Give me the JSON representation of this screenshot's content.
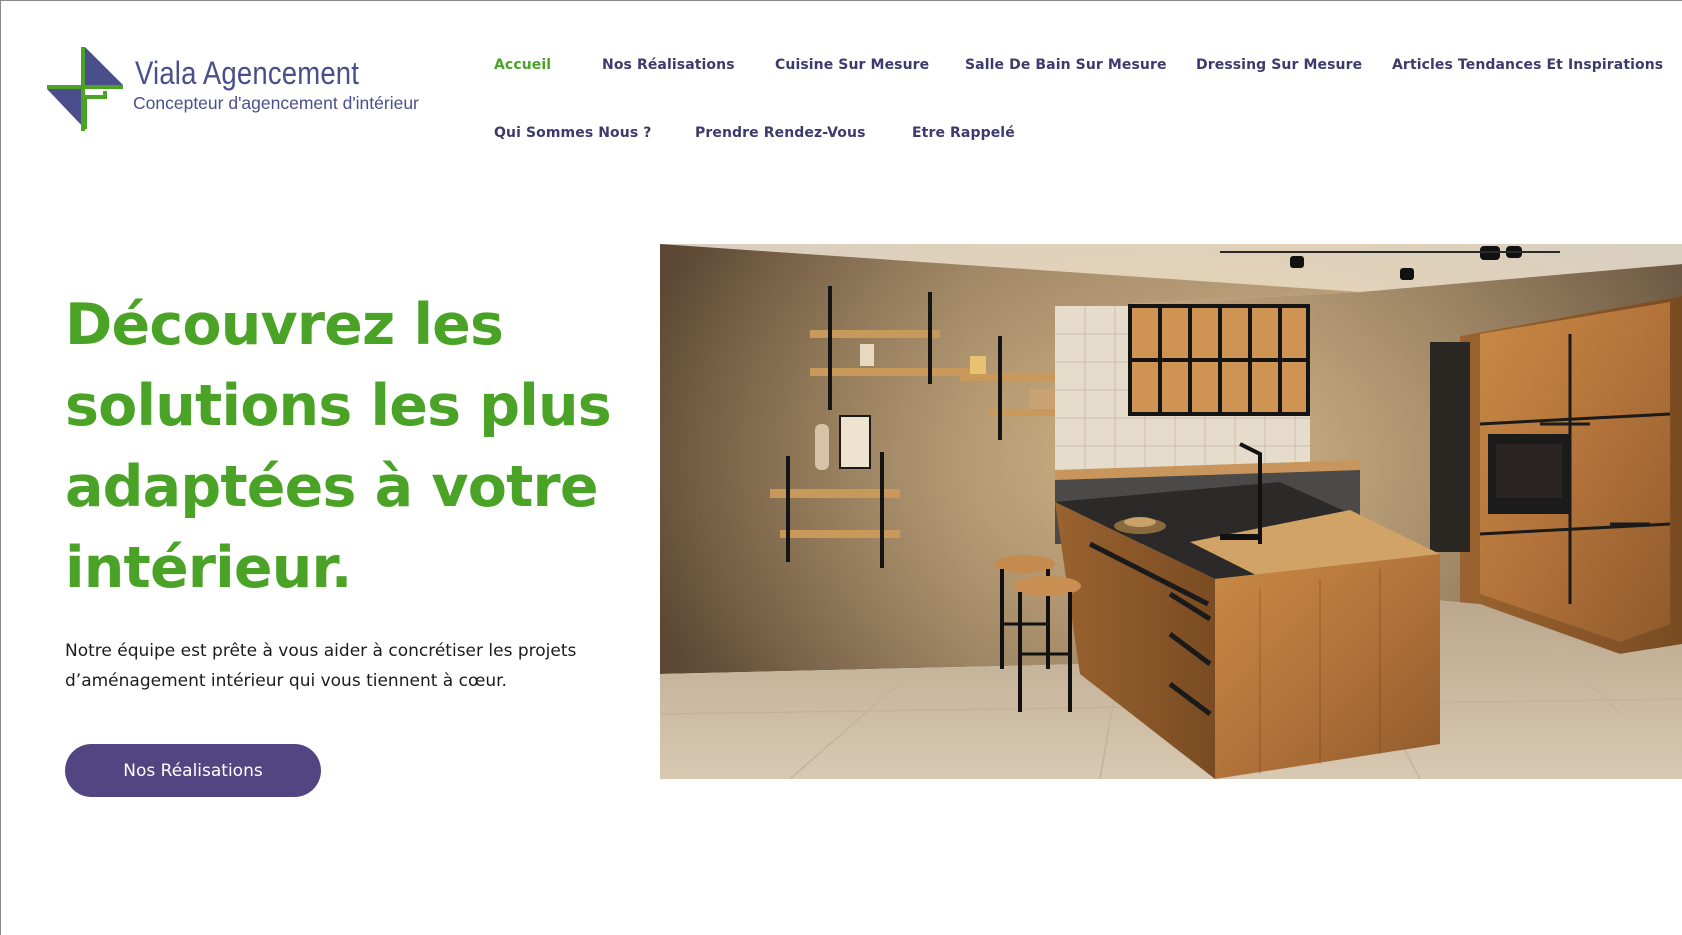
{
  "brand": {
    "name": "Viala Agencement",
    "tagline": "Concepteur d'agencement d'intérieur",
    "colors": {
      "green": "#4aa326",
      "purple": "#524682",
      "nav_text": "#3e3a6d"
    }
  },
  "nav": {
    "items": [
      {
        "label": "Accueil",
        "active": true
      },
      {
        "label": "Nos Réalisations"
      },
      {
        "label": "Cuisine Sur Mesure"
      },
      {
        "label": "Salle De Bain Sur Mesure"
      },
      {
        "label": "Dressing Sur Mesure"
      },
      {
        "label": "Articles Tendances Et Inspirations"
      },
      {
        "label": "Qui Sommes Nous ?"
      },
      {
        "label": "Prendre Rendez-Vous"
      },
      {
        "label": "Etre Rappelé"
      }
    ]
  },
  "hero": {
    "title": "Découvrez les solutions les plus adaptées à votre intérieur.",
    "text": "Notre équipe est prête à vous aider à concrétiser les projets d’aménagement intérieur qui vous tiennent à cœur.",
    "button_label": "Nos Réalisations",
    "image_alt": "kitchen-photo"
  }
}
